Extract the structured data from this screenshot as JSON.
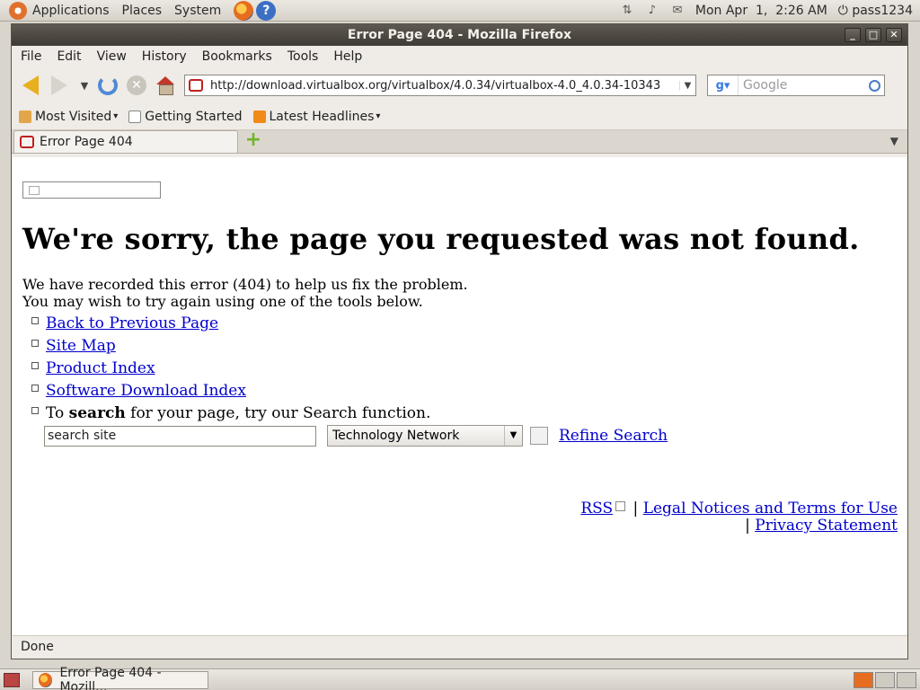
{
  "top_panel": {
    "menus": [
      "Applications",
      "Places",
      "System"
    ],
    "clock": "Mon Apr  1,  2:26 AM",
    "user": "pass1234"
  },
  "window": {
    "title": "Error Page 404 - Mozilla Firefox"
  },
  "menubar": [
    "File",
    "Edit",
    "View",
    "History",
    "Bookmarks",
    "Tools",
    "Help"
  ],
  "navbar": {
    "url": "http://download.virtualbox.org/virtualbox/4.0.34/virtualbox-4.0_4.0.34-10343",
    "search_placeholder": "Google"
  },
  "bookmarks": [
    "Most Visited",
    "Getting Started",
    "Latest Headlines"
  ],
  "tab": {
    "title": "Error Page 404"
  },
  "page": {
    "heading": "We're sorry, the page you requested was not found.",
    "msg_line1": "We have recorded this error (404) to help us fix the problem.",
    "msg_line2": "You may wish to try again using one of the tools below.",
    "links": [
      "Back to Previous Page",
      "Site Map",
      "Product Index",
      "Software Download Index"
    ],
    "search_prefix": "To ",
    "search_bold": "search",
    "search_suffix": " for your page, try our Search function.",
    "search_input_value": "search site",
    "search_scope": "Technology Network",
    "refine": "Refine Search",
    "footer_rss": "RSS",
    "footer_sep": " | ",
    "footer_legal": "Legal Notices and Terms for Use",
    "footer_privacy": "Privacy Statement"
  },
  "status": "Done",
  "taskbar": {
    "task_label": "Error Page 404 - Mozill..."
  }
}
